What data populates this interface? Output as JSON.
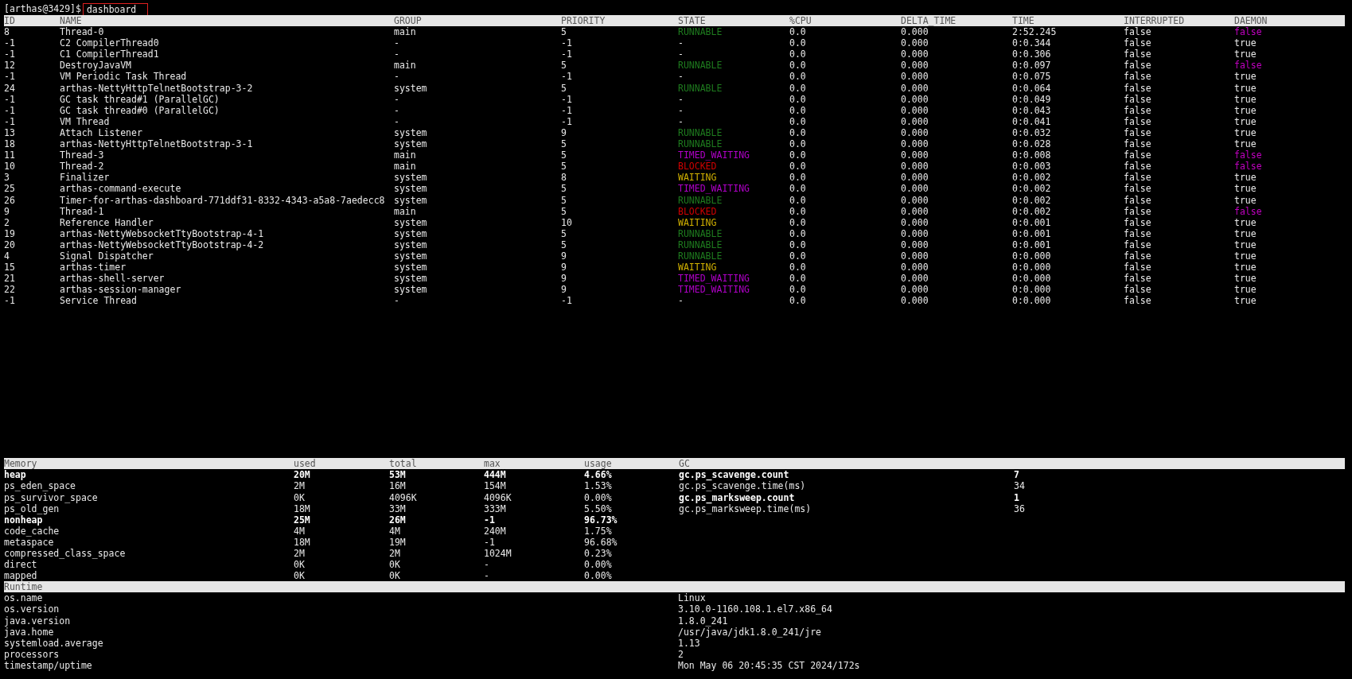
{
  "prompt": "[arthas@3429]$",
  "command": "dashboard",
  "threads": {
    "columns": [
      "ID",
      "NAME",
      "GROUP",
      "PRIORITY",
      "STATE",
      "%CPU",
      "DELTA_TIME",
      "TIME",
      "INTERRUPTED",
      "DAEMON"
    ],
    "rows": [
      {
        "id": "8",
        "name": "Thread-0",
        "group": "main",
        "priority": "5",
        "state": {
          "text": "RUNNABLE",
          "color": "#1e7b1e"
        },
        "cpu": "0.0",
        "delta_time": "0.000",
        "time": "2:52.245",
        "interrupted": "false",
        "daemon": {
          "text": "false",
          "color": "#c000c0"
        }
      },
      {
        "id": "-1",
        "name": "C2 CompilerThread0",
        "group": "-",
        "priority": "-1",
        "state": {
          "text": "-"
        },
        "cpu": "0.0",
        "delta_time": "0.000",
        "time": "0:0.344",
        "interrupted": "false",
        "daemon": {
          "text": "true",
          "color": "#e8e8e8"
        }
      },
      {
        "id": "-1",
        "name": "C1 CompilerThread1",
        "group": "-",
        "priority": "-1",
        "state": {
          "text": "-"
        },
        "cpu": "0.0",
        "delta_time": "0.000",
        "time": "0:0.306",
        "interrupted": "false",
        "daemon": {
          "text": "true",
          "color": "#e8e8e8"
        }
      },
      {
        "id": "12",
        "name": "DestroyJavaVM",
        "group": "main",
        "priority": "5",
        "state": {
          "text": "RUNNABLE",
          "color": "#1e7b1e"
        },
        "cpu": "0.0",
        "delta_time": "0.000",
        "time": "0:0.097",
        "interrupted": "false",
        "daemon": {
          "text": "false",
          "color": "#c000c0"
        }
      },
      {
        "id": "-1",
        "name": "VM Periodic Task Thread",
        "group": "-",
        "priority": "-1",
        "state": {
          "text": "-"
        },
        "cpu": "0.0",
        "delta_time": "0.000",
        "time": "0:0.075",
        "interrupted": "false",
        "daemon": {
          "text": "true",
          "color": "#e8e8e8"
        }
      },
      {
        "id": "24",
        "name": "arthas-NettyHttpTelnetBootstrap-3-2",
        "group": "system",
        "priority": "5",
        "state": {
          "text": "RUNNABLE",
          "color": "#1e7b1e"
        },
        "cpu": "0.0",
        "delta_time": "0.000",
        "time": "0:0.064",
        "interrupted": "false",
        "daemon": {
          "text": "true",
          "color": "#e8e8e8"
        }
      },
      {
        "id": "-1",
        "name": "GC task thread#1 (ParallelGC)",
        "group": "-",
        "priority": "-1",
        "state": {
          "text": "-"
        },
        "cpu": "0.0",
        "delta_time": "0.000",
        "time": "0:0.049",
        "interrupted": "false",
        "daemon": {
          "text": "true",
          "color": "#e8e8e8"
        }
      },
      {
        "id": "-1",
        "name": "GC task thread#0 (ParallelGC)",
        "group": "-",
        "priority": "-1",
        "state": {
          "text": "-"
        },
        "cpu": "0.0",
        "delta_time": "0.000",
        "time": "0:0.043",
        "interrupted": "false",
        "daemon": {
          "text": "true",
          "color": "#e8e8e8"
        }
      },
      {
        "id": "-1",
        "name": "VM Thread",
        "group": "-",
        "priority": "-1",
        "state": {
          "text": "-"
        },
        "cpu": "0.0",
        "delta_time": "0.000",
        "time": "0:0.041",
        "interrupted": "false",
        "daemon": {
          "text": "true",
          "color": "#e8e8e8"
        }
      },
      {
        "id": "13",
        "name": "Attach Listener",
        "group": "system",
        "priority": "9",
        "state": {
          "text": "RUNNABLE",
          "color": "#1e7b1e"
        },
        "cpu": "0.0",
        "delta_time": "0.000",
        "time": "0:0.032",
        "interrupted": "false",
        "daemon": {
          "text": "true",
          "color": "#e8e8e8"
        }
      },
      {
        "id": "18",
        "name": "arthas-NettyHttpTelnetBootstrap-3-1",
        "group": "system",
        "priority": "5",
        "state": {
          "text": "RUNNABLE",
          "color": "#1e7b1e"
        },
        "cpu": "0.0",
        "delta_time": "0.000",
        "time": "0:0.028",
        "interrupted": "false",
        "daemon": {
          "text": "true",
          "color": "#e8e8e8"
        }
      },
      {
        "id": "11",
        "name": "Thread-3",
        "group": "main",
        "priority": "5",
        "state": {
          "text": "TIMED_WAITING",
          "color": "#b000c8"
        },
        "cpu": "0.0",
        "delta_time": "0.000",
        "time": "0:0.008",
        "interrupted": "false",
        "daemon": {
          "text": "false",
          "color": "#c000c0"
        }
      },
      {
        "id": "10",
        "name": "Thread-2",
        "group": "main",
        "priority": "5",
        "state": {
          "text": "BLOCKED",
          "color": "#d00000"
        },
        "cpu": "0.0",
        "delta_time": "0.000",
        "time": "0:0.003",
        "interrupted": "false",
        "daemon": {
          "text": "false",
          "color": "#c000c0"
        }
      },
      {
        "id": "3",
        "name": "Finalizer",
        "group": "system",
        "priority": "8",
        "state": {
          "text": "WAITING",
          "color": "#d0b000"
        },
        "cpu": "0.0",
        "delta_time": "0.000",
        "time": "0:0.002",
        "interrupted": "false",
        "daemon": {
          "text": "true",
          "color": "#e8e8e8"
        }
      },
      {
        "id": "25",
        "name": "arthas-command-execute",
        "group": "system",
        "priority": "5",
        "state": {
          "text": "TIMED_WAITING",
          "color": "#b000c8"
        },
        "cpu": "0.0",
        "delta_time": "0.000",
        "time": "0:0.002",
        "interrupted": "false",
        "daemon": {
          "text": "true",
          "color": "#e8e8e8"
        }
      },
      {
        "id": "26",
        "name": "Timer-for-arthas-dashboard-771ddf31-8332-4343-a5a8-7aedecc8",
        "group": "system",
        "priority": "5",
        "state": {
          "text": "RUNNABLE",
          "color": "#1e7b1e"
        },
        "cpu": "0.0",
        "delta_time": "0.000",
        "time": "0:0.002",
        "interrupted": "false",
        "daemon": {
          "text": "true",
          "color": "#e8e8e8"
        }
      },
      {
        "id": "9",
        "name": "Thread-1",
        "group": "main",
        "priority": "5",
        "state": {
          "text": "BLOCKED",
          "color": "#d00000"
        },
        "cpu": "0.0",
        "delta_time": "0.000",
        "time": "0:0.002",
        "interrupted": "false",
        "daemon": {
          "text": "false",
          "color": "#c000c0"
        }
      },
      {
        "id": "2",
        "name": "Reference Handler",
        "group": "system",
        "priority": "10",
        "state": {
          "text": "WAITING",
          "color": "#d0b000"
        },
        "cpu": "0.0",
        "delta_time": "0.000",
        "time": "0:0.001",
        "interrupted": "false",
        "daemon": {
          "text": "true",
          "color": "#e8e8e8"
        }
      },
      {
        "id": "19",
        "name": "arthas-NettyWebsocketTtyBootstrap-4-1",
        "group": "system",
        "priority": "5",
        "state": {
          "text": "RUNNABLE",
          "color": "#1e7b1e"
        },
        "cpu": "0.0",
        "delta_time": "0.000",
        "time": "0:0.001",
        "interrupted": "false",
        "daemon": {
          "text": "true",
          "color": "#e8e8e8"
        }
      },
      {
        "id": "20",
        "name": "arthas-NettyWebsocketTtyBootstrap-4-2",
        "group": "system",
        "priority": "5",
        "state": {
          "text": "RUNNABLE",
          "color": "#1e7b1e"
        },
        "cpu": "0.0",
        "delta_time": "0.000",
        "time": "0:0.001",
        "interrupted": "false",
        "daemon": {
          "text": "true",
          "color": "#e8e8e8"
        }
      },
      {
        "id": "4",
        "name": "Signal Dispatcher",
        "group": "system",
        "priority": "9",
        "state": {
          "text": "RUNNABLE",
          "color": "#1e7b1e"
        },
        "cpu": "0.0",
        "delta_time": "0.000",
        "time": "0:0.000",
        "interrupted": "false",
        "daemon": {
          "text": "true",
          "color": "#e8e8e8"
        }
      },
      {
        "id": "15",
        "name": "arthas-timer",
        "group": "system",
        "priority": "9",
        "state": {
          "text": "WAITING",
          "color": "#d0b000"
        },
        "cpu": "0.0",
        "delta_time": "0.000",
        "time": "0:0.000",
        "interrupted": "false",
        "daemon": {
          "text": "true",
          "color": "#e8e8e8"
        }
      },
      {
        "id": "21",
        "name": "arthas-shell-server",
        "group": "system",
        "priority": "9",
        "state": {
          "text": "TIMED_WAITING",
          "color": "#b000c8"
        },
        "cpu": "0.0",
        "delta_time": "0.000",
        "time": "0:0.000",
        "interrupted": "false",
        "daemon": {
          "text": "true",
          "color": "#e8e8e8"
        }
      },
      {
        "id": "22",
        "name": "arthas-session-manager",
        "group": "system",
        "priority": "9",
        "state": {
          "text": "TIMED_WAITING",
          "color": "#b000c8"
        },
        "cpu": "0.0",
        "delta_time": "0.000",
        "time": "0:0.000",
        "interrupted": "false",
        "daemon": {
          "text": "true",
          "color": "#e8e8e8"
        }
      },
      {
        "id": "-1",
        "name": "Service Thread",
        "group": "-",
        "priority": "-1",
        "state": {
          "text": "-"
        },
        "cpu": "0.0",
        "delta_time": "0.000",
        "time": "0:0.000",
        "interrupted": "false",
        "daemon": {
          "text": "true",
          "color": "#e8e8e8"
        }
      }
    ]
  },
  "memory": {
    "columns": [
      "Memory",
      "used",
      "total",
      "max",
      "usage",
      "GC"
    ],
    "rows": [
      {
        "name": "heap",
        "used": "20M",
        "total": "53M",
        "max": "444M",
        "usage": "4.66%",
        "bold": true
      },
      {
        "name": "ps_eden_space",
        "used": "2M",
        "total": "16M",
        "max": "154M",
        "usage": "1.53%",
        "bold": false
      },
      {
        "name": "ps_survivor_space",
        "used": "0K",
        "total": "4096K",
        "max": "4096K",
        "usage": "0.00%",
        "bold": false
      },
      {
        "name": "ps_old_gen",
        "used": "18M",
        "total": "33M",
        "max": "333M",
        "usage": "5.50%",
        "bold": false
      },
      {
        "name": "nonheap",
        "used": "25M",
        "total": "26M",
        "max": "-1",
        "usage": "96.73%",
        "bold": true
      },
      {
        "name": "code_cache",
        "used": "4M",
        "total": "4M",
        "max": "240M",
        "usage": "1.75%",
        "bold": false
      },
      {
        "name": "metaspace",
        "used": "18M",
        "total": "19M",
        "max": "-1",
        "usage": "96.68%",
        "bold": false
      },
      {
        "name": "compressed_class_space",
        "used": "2M",
        "total": "2M",
        "max": "1024M",
        "usage": "0.23%",
        "bold": false
      },
      {
        "name": "direct",
        "used": "0K",
        "total": "0K",
        "max": "-",
        "usage": "0.00%",
        "bold": false
      },
      {
        "name": "mapped",
        "used": "0K",
        "total": "0K",
        "max": "-",
        "usage": "0.00%",
        "bold": false
      }
    ],
    "gc": [
      {
        "name": "gc.ps_scavenge.count",
        "value": "7",
        "bold": true
      },
      {
        "name": "gc.ps_scavenge.time(ms)",
        "value": "34",
        "bold": false
      },
      {
        "name": "gc.ps_marksweep.count",
        "value": "1",
        "bold": true
      },
      {
        "name": "gc.ps_marksweep.time(ms)",
        "value": "36",
        "bold": false
      }
    ]
  },
  "runtime": {
    "title": "Runtime",
    "rows": [
      {
        "name": "os.name",
        "value": "Linux"
      },
      {
        "name": "os.version",
        "value": "3.10.0-1160.108.1.el7.x86_64"
      },
      {
        "name": "java.version",
        "value": "1.8.0_241"
      },
      {
        "name": "java.home",
        "value": "/usr/java/jdk1.8.0_241/jre"
      },
      {
        "name": "systemload.average",
        "value": "1.13"
      },
      {
        "name": "processors",
        "value": "2"
      },
      {
        "name": "timestamp/uptime",
        "value": "Mon May 06 20:45:35 CST 2024/172s"
      }
    ]
  }
}
